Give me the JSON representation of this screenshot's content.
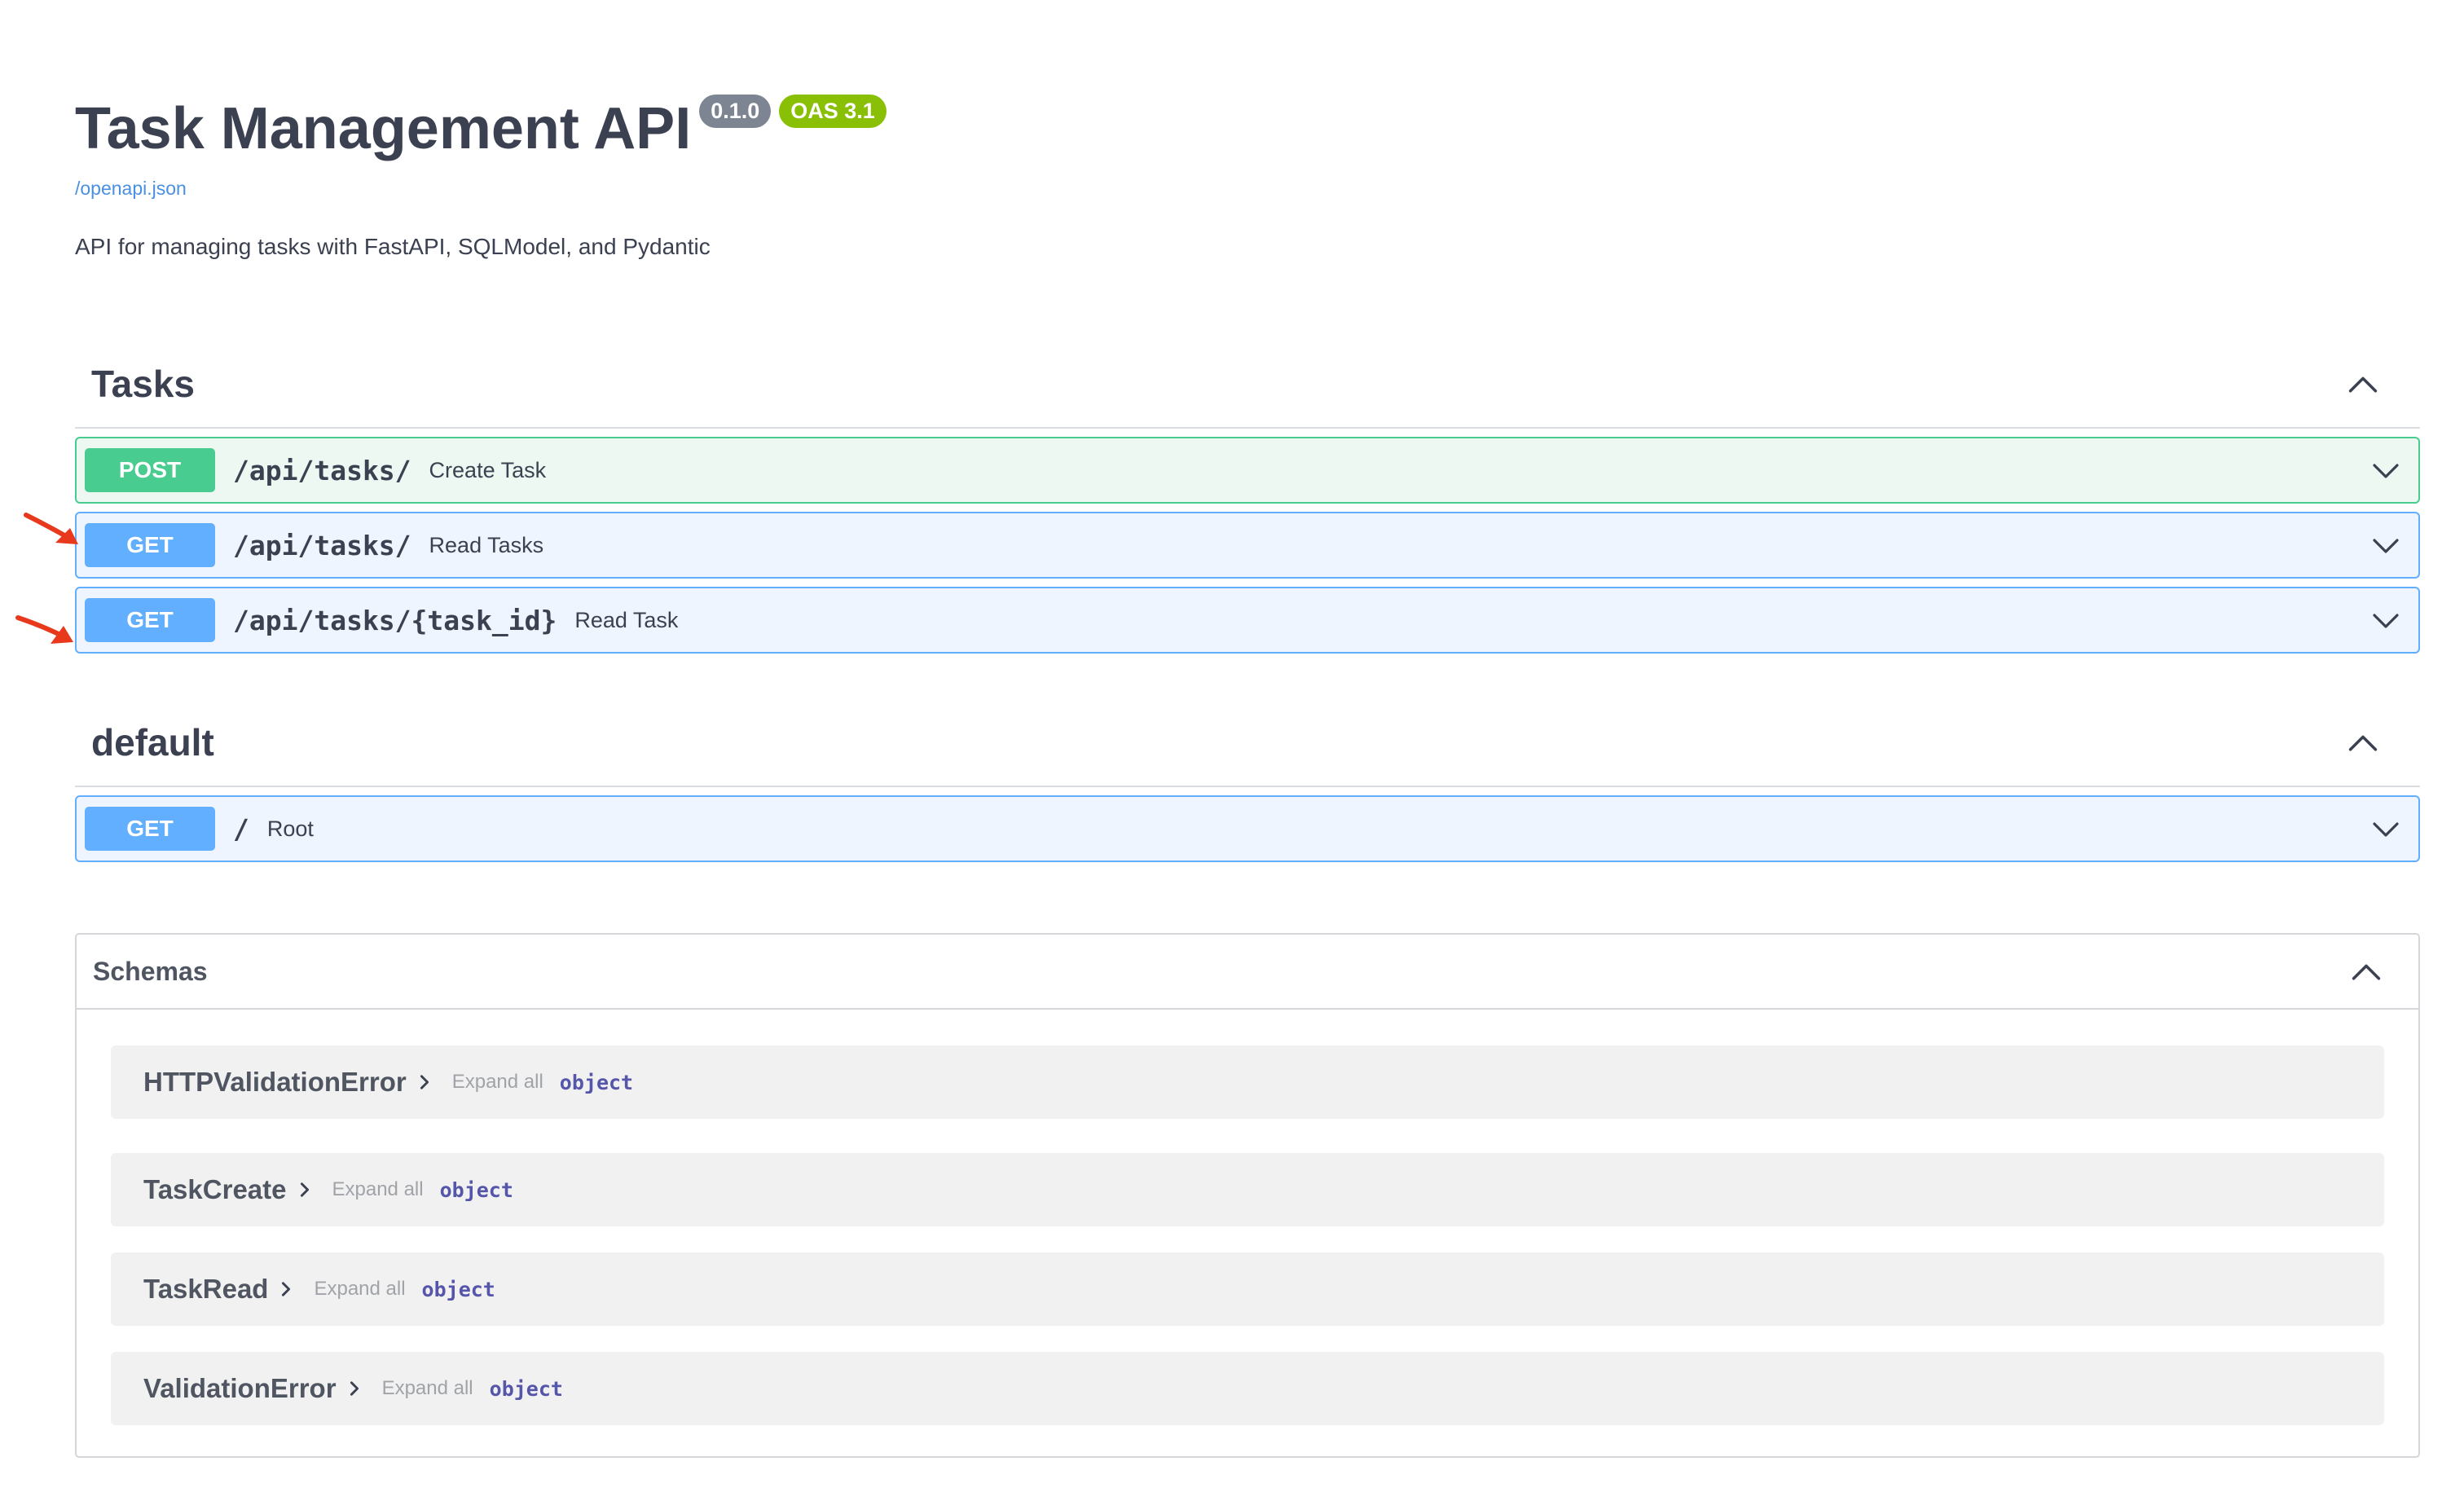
{
  "info": {
    "title": "Task Management API",
    "version": "0.1.0",
    "oas": "OAS 3.1",
    "spec_link": "/openapi.json",
    "description": "API for managing tasks with FastAPI, SQLModel, and Pydantic"
  },
  "tags": [
    {
      "name": "Tasks",
      "operations": [
        {
          "method": "POST",
          "path": "/api/tasks/",
          "summary": "Create Task"
        },
        {
          "method": "GET",
          "path": "/api/tasks/",
          "summary": "Read Tasks"
        },
        {
          "method": "GET",
          "path": "/api/tasks/{task_id}",
          "summary": "Read Task"
        }
      ]
    },
    {
      "name": "default",
      "operations": [
        {
          "method": "GET",
          "path": "/",
          "summary": "Root"
        }
      ]
    }
  ],
  "schemas": {
    "title": "Schemas",
    "expand_all_label": "Expand all",
    "models": [
      {
        "name": "HTTPValidationError",
        "type": "object"
      },
      {
        "name": "TaskCreate",
        "type": "object"
      },
      {
        "name": "TaskRead",
        "type": "object"
      },
      {
        "name": "ValidationError",
        "type": "object"
      }
    ]
  },
  "colors": {
    "post": "#49cc90",
    "get": "#61affe",
    "annotation_arrow": "#e8391d",
    "badge_version": "#7d8492",
    "badge_oas": "#89bf04"
  },
  "icons": {
    "section_collapse": "chevron-up-icon",
    "operation_expand": "chevron-down-icon",
    "model_expand": "chevron-right-icon",
    "annotation": "red-arrow-icon"
  }
}
